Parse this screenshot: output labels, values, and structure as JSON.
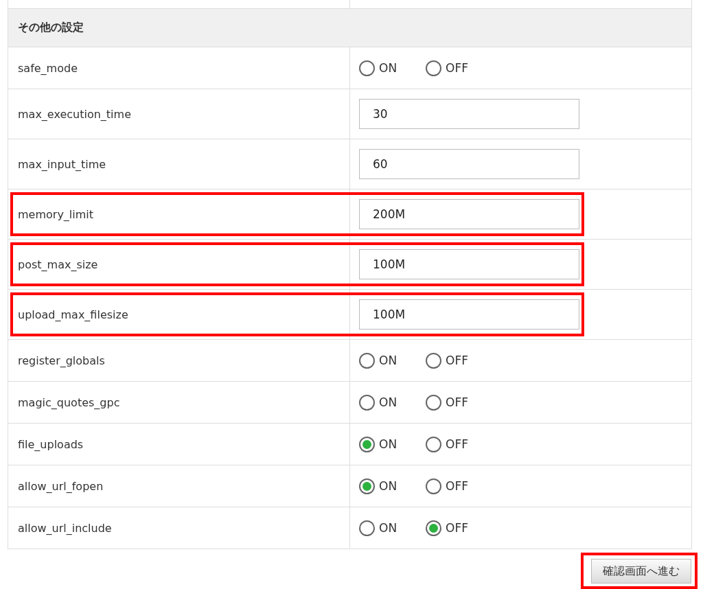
{
  "section_title": "その他の設定",
  "rows": [
    {
      "kind": "radio",
      "name": "safe_mode",
      "highlighted": false,
      "options": [
        {
          "label": "ON",
          "selected": false
        },
        {
          "label": "OFF",
          "selected": false
        }
      ]
    },
    {
      "kind": "text",
      "name": "max_execution_time",
      "highlighted": false,
      "value": "30"
    },
    {
      "kind": "text",
      "name": "max_input_time",
      "highlighted": false,
      "value": "60"
    },
    {
      "kind": "text",
      "name": "memory_limit",
      "highlighted": true,
      "value": "200M"
    },
    {
      "kind": "text",
      "name": "post_max_size",
      "highlighted": true,
      "value": "100M"
    },
    {
      "kind": "text",
      "name": "upload_max_filesize",
      "highlighted": true,
      "value": "100M"
    },
    {
      "kind": "radio",
      "name": "register_globals",
      "highlighted": false,
      "options": [
        {
          "label": "ON",
          "selected": false
        },
        {
          "label": "OFF",
          "selected": false
        }
      ]
    },
    {
      "kind": "radio",
      "name": "magic_quotes_gpc",
      "highlighted": false,
      "options": [
        {
          "label": "ON",
          "selected": false
        },
        {
          "label": "OFF",
          "selected": false
        }
      ]
    },
    {
      "kind": "radio",
      "name": "file_uploads",
      "highlighted": false,
      "options": [
        {
          "label": "ON",
          "selected": true
        },
        {
          "label": "OFF",
          "selected": false
        }
      ]
    },
    {
      "kind": "radio",
      "name": "allow_url_fopen",
      "highlighted": false,
      "options": [
        {
          "label": "ON",
          "selected": true
        },
        {
          "label": "OFF",
          "selected": false
        }
      ]
    },
    {
      "kind": "radio",
      "name": "allow_url_include",
      "highlighted": false,
      "options": [
        {
          "label": "ON",
          "selected": false
        },
        {
          "label": "OFF",
          "selected": true
        }
      ]
    }
  ],
  "submit": {
    "label": "確認画面へ進む",
    "highlighted": true
  }
}
